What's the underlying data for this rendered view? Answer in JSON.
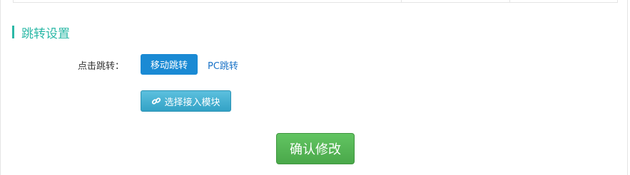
{
  "section": {
    "title": "跳转设置"
  },
  "jump": {
    "label": "点击跳转：",
    "mobile_button": "移动跳转",
    "pc_link": "PC跳转"
  },
  "module": {
    "button_label": "选择接入模块",
    "icon": "link-icon"
  },
  "confirm": {
    "button_label": "确认修改"
  },
  "colors": {
    "accent": "#2bb8a6",
    "primary": "#1a8ad4",
    "info": "#33a2c6",
    "success": "#4aa84a"
  }
}
